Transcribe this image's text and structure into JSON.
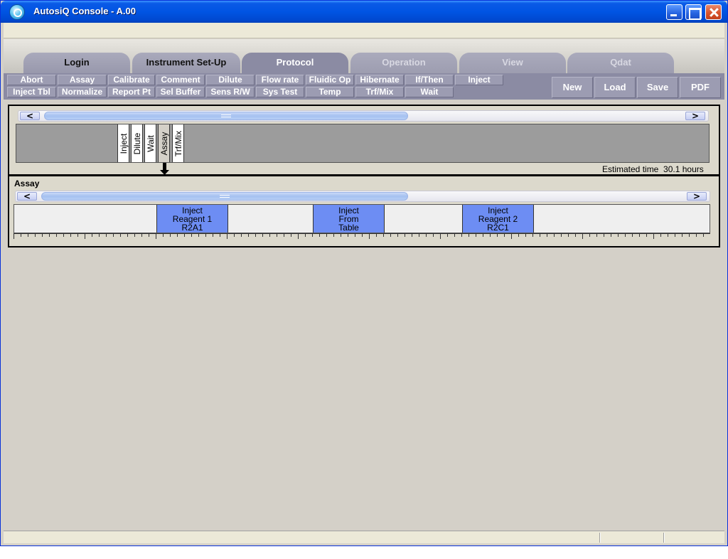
{
  "window": {
    "title": "AutosiQ Console - A.00"
  },
  "tabs": [
    {
      "label": "Login",
      "state": "normal"
    },
    {
      "label": "Instrument Set-Up",
      "state": "normal"
    },
    {
      "label": "Protocol",
      "state": "active"
    },
    {
      "label": "Operation",
      "state": "disabled"
    },
    {
      "label": "View",
      "state": "disabled"
    },
    {
      "label": "Qdat",
      "state": "disabled"
    }
  ],
  "commands": {
    "row1": [
      "Abort",
      "Assay",
      "Calibrate",
      "Comment",
      "Dilute",
      "Flow rate",
      "Fluidic Op",
      "Hibernate",
      "If/Then",
      "Inject"
    ],
    "row2": [
      "Inject Tbl",
      "Normalize",
      "Report Pt",
      "Sel Buffer",
      "Sens R/W",
      "Sys Test",
      "Temp",
      "Trf/Mix",
      "Wait"
    ]
  },
  "file_buttons": [
    "New",
    "Load",
    "Save",
    "PDF"
  ],
  "protocol": {
    "steps": [
      "Inject",
      "Dilute",
      "Wait",
      "Assay",
      "Trf/Mix"
    ],
    "selected_step": "Assay",
    "estimated_label": "Estimated time",
    "estimated_value": "30.1 hours",
    "scroll_left": "<",
    "scroll_right": ">"
  },
  "assay": {
    "title": "Assay",
    "scroll_left": "<",
    "scroll_right": ">",
    "blocks": [
      {
        "line1": "Inject",
        "line2": "Reagent 1",
        "line3": "R2A1"
      },
      {
        "line1": "Inject",
        "line2": "From",
        "line3": "Table"
      },
      {
        "line1": "Inject",
        "line2": "Reagent 2",
        "line3": "R2C1"
      }
    ]
  },
  "icons": {
    "app": "autosiq-logo-icon",
    "minimize": "minimize-icon",
    "maximize": "maximize-icon",
    "close": "close-icon",
    "selected_arrow": "arrow-down-icon"
  },
  "colors": {
    "titlebar": "#0054e3",
    "tab_active": "#8b8ba3",
    "command_bar": "#8b8ba3",
    "block": "#6d8df3",
    "timeline_bg": "#9c9c9c"
  }
}
